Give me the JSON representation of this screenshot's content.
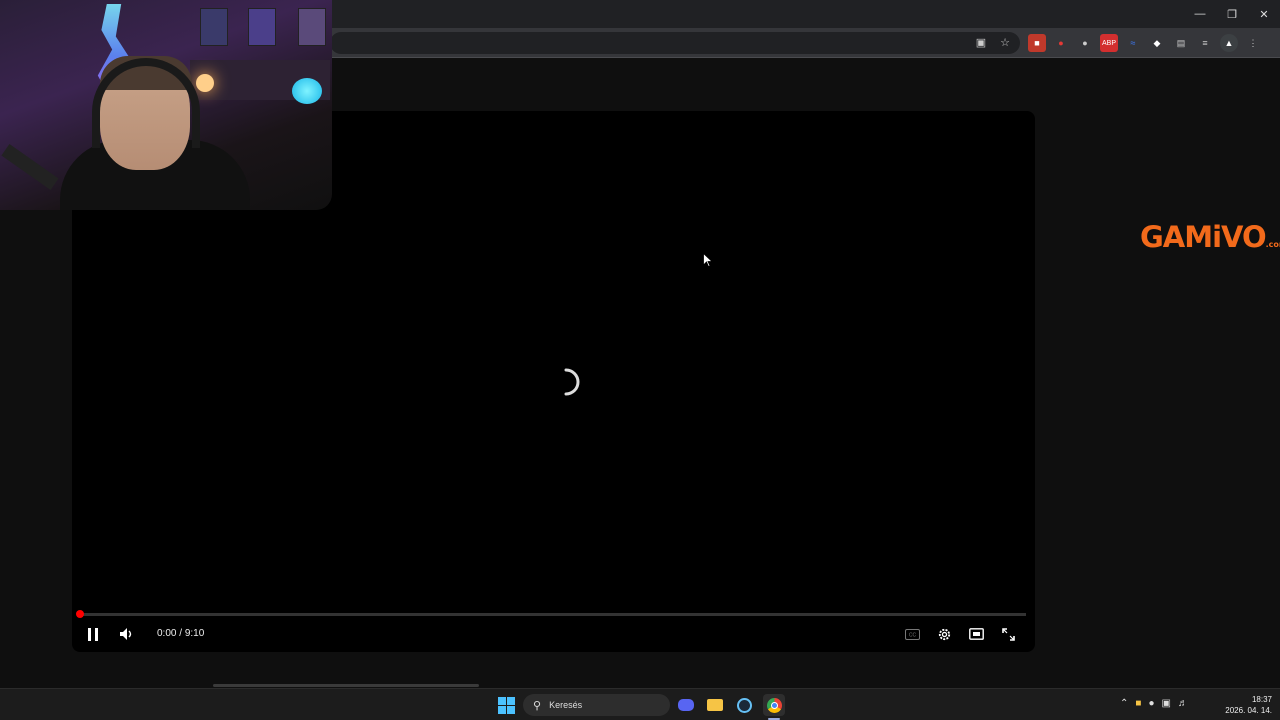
{
  "player": {
    "time_current": "0:00",
    "time_separator": " / ",
    "time_total": "9:10",
    "progress": 0.0
  },
  "ad": {
    "brand_main": "GAMiVO",
    "brand_sub": ".com"
  },
  "taskbar": {
    "search_label": "Keresés",
    "clock_time": "18:37",
    "clock_date": "2026. 04. 14."
  },
  "colors": {
    "progress": "#ff0000",
    "brand": "#f26a1b",
    "background": "#0f0f0f"
  }
}
